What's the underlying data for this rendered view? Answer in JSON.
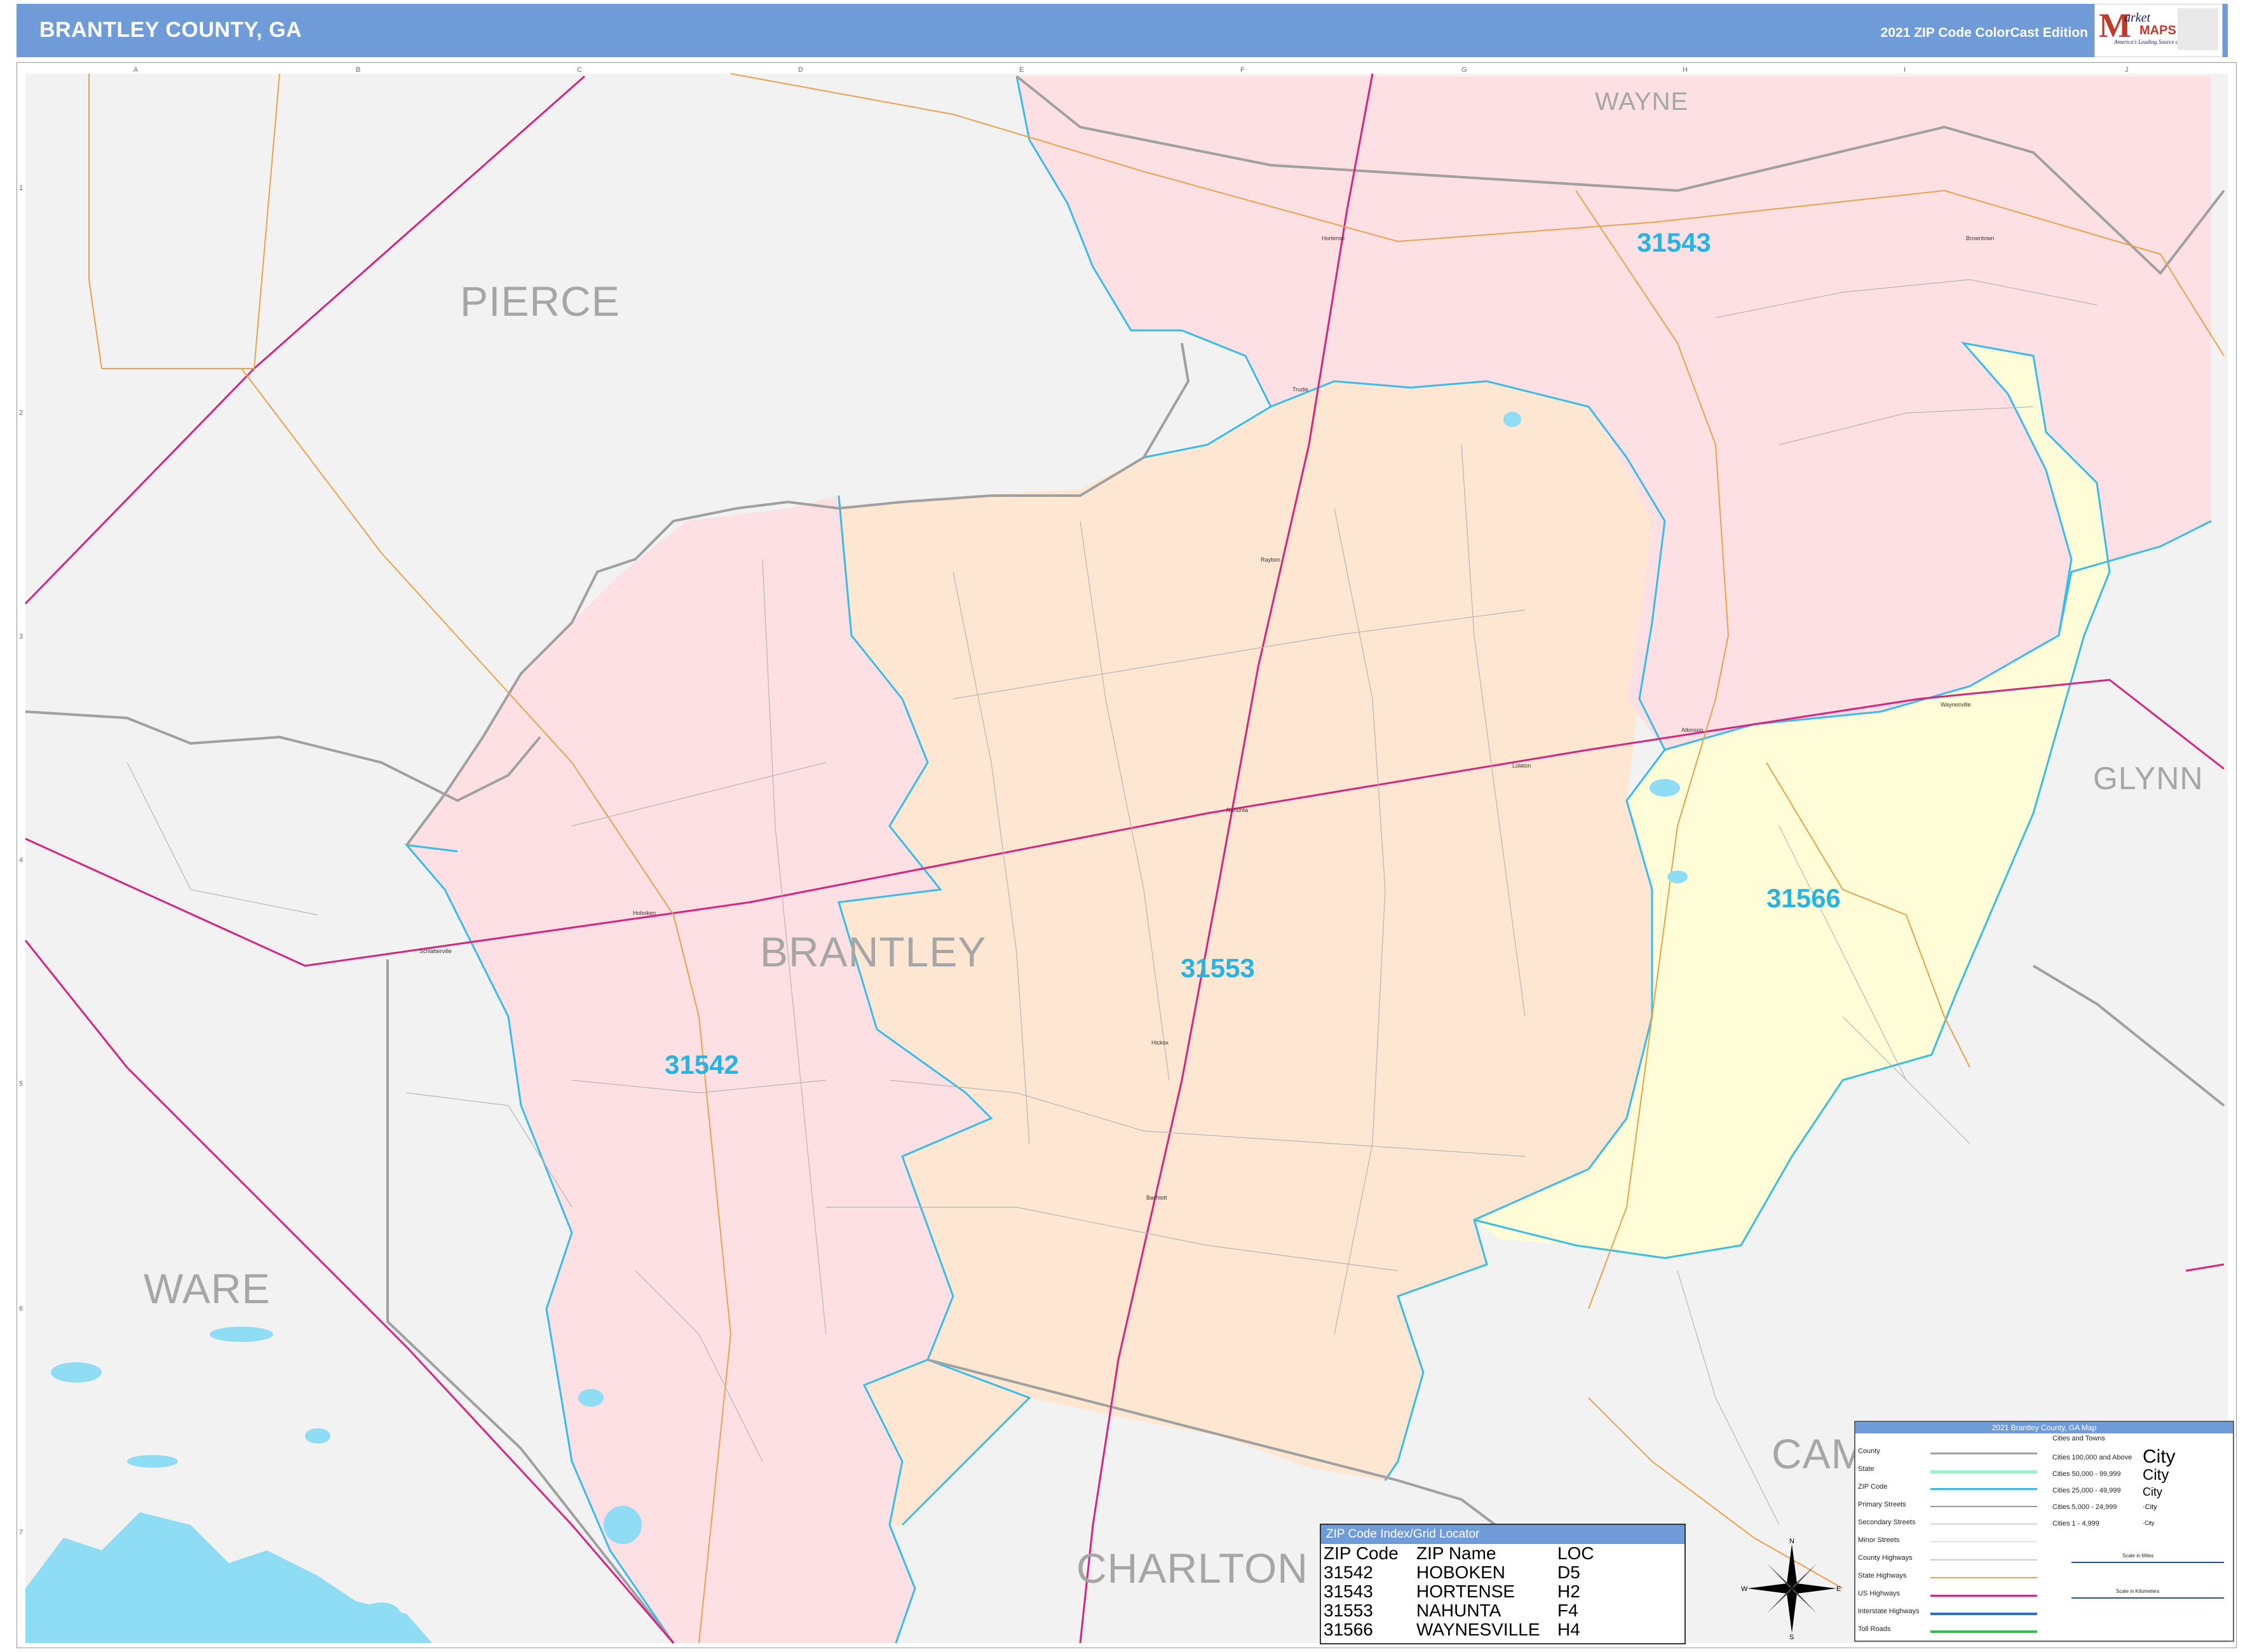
{
  "header": {
    "title": "BRANTLEY COUNTY, GA",
    "edition": "2021 ZIP Code ColorCast Edition",
    "logo": {
      "m": "M",
      "arket": "arket",
      "maps": "MAPS",
      "tagline": "America's Leading Source of Business Maps"
    }
  },
  "grid": {
    "letters": [
      "A",
      "B",
      "C",
      "D",
      "E",
      "F",
      "G",
      "H",
      "I",
      "J"
    ],
    "numbers": [
      "1",
      "2",
      "3",
      "4",
      "5",
      "6",
      "7"
    ]
  },
  "counties": {
    "pierce": "PIERCE",
    "wayne": "WAYNE",
    "glynn": "GLYNN",
    "brantley": "BRANTLEY",
    "ware": "WARE",
    "charlton": "CHARLTON",
    "camden": "CAM"
  },
  "zips": {
    "z31543": "31543",
    "z31553": "31553",
    "z31542": "31542",
    "z31566": "31566"
  },
  "places": {
    "hortense": "Hortense",
    "trudie": "Trudie",
    "raybon": "Raybon",
    "nahunta": "Nahunta",
    "hoboken": "Hoboken",
    "schlatterville": "Schlatterville",
    "hickox": "Hickox",
    "atkinson": "Atkinson",
    "waynesville": "Waynesville",
    "browntown": "Browntown",
    "lulaton": "Lulaton",
    "nahunta_area": "Nahunta",
    "sadie": "Sadie",
    "bachlott": "Bachlott"
  },
  "zip_index": {
    "title": "ZIP Code Index/Grid Locator",
    "headers": [
      "ZIP Code",
      "ZIP Name",
      "LOC"
    ],
    "rows": [
      [
        "31542",
        "HOBOKEN",
        "D5"
      ],
      [
        "31543",
        "HORTENSE",
        "H2"
      ],
      [
        "31553",
        "NAHUNTA",
        "F4"
      ],
      [
        "31566",
        "WAYNESVILLE",
        "H4"
      ]
    ]
  },
  "legend": {
    "title": "2021 Brantley County, GA Map",
    "items": [
      "County",
      "State",
      "ZIP Code",
      "Primary Streets",
      "Secondary Streets",
      "Minor Streets",
      "County Highways",
      "State Highways",
      "US Highways",
      "Interstate Highways",
      "Toll Roads"
    ],
    "cities_header": "Cities and Towns",
    "city_classes": [
      "Cities 100,000 and Above",
      "Cities 50,000 - 99,999",
      "Cities 25,000 - 49,999",
      "Cities 5,000 - 24,999",
      "Cities 1 - 4,999"
    ],
    "city_sample": "City",
    "city_sample_small": "·City",
    "scale_miles": "Scale in Miles",
    "scale_km": "Scale in Kilometers"
  },
  "compass": {
    "n": "N",
    "s": "S",
    "e": "E",
    "w": "W"
  },
  "colors": {
    "title_bar": "#6f9cd8",
    "zip_label": "#25b4e6",
    "zip_31543": "#fde0e4",
    "zip_31542": "#fde0e4",
    "zip_31553": "#fde6d2",
    "zip_31566": "#fffcd8",
    "outside": "#f2f2f2",
    "zip_border": "#38bdea",
    "us_highway": "#d8237f",
    "state_highway": "#e8a34a",
    "water": "#8fdcf5"
  }
}
